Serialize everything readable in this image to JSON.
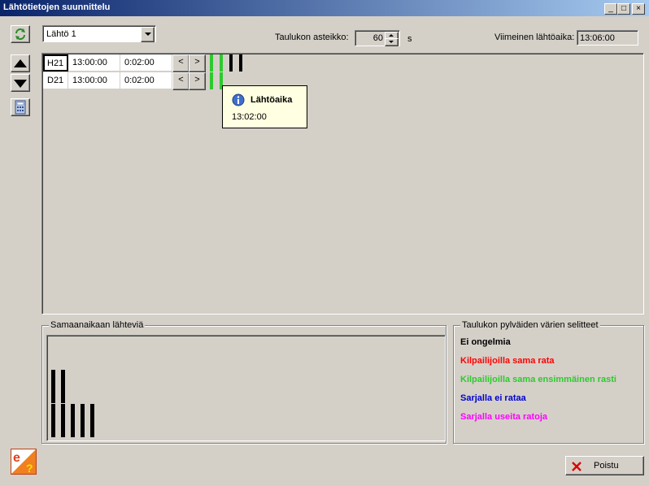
{
  "window": {
    "title": "Lähtötietojen suunnittelu",
    "minimize": "_",
    "maximize": "□",
    "close": "×"
  },
  "toolbar": {
    "start_select": "Lähtö 1",
    "scale_label": "Taulukon asteikko:",
    "scale_value": "60",
    "scale_unit": "s",
    "last_start_label": "Viimeinen lähtöaika:",
    "last_start_value": "13:06:00"
  },
  "table": {
    "rows": [
      {
        "cls": "H21",
        "start": "13:00:00",
        "interval": "0:02:00",
        "prev": "<",
        "next": ">"
      },
      {
        "cls": "D21",
        "start": "13:00:00",
        "interval": "0:02:00",
        "prev": "<",
        "next": ">"
      }
    ]
  },
  "tooltip": {
    "title": "Lähtöaika",
    "value": "13:02:00",
    "icon": "info-icon"
  },
  "simultaneous": {
    "title": "Samaanaikaan lähteviä",
    "bars": [
      2,
      2,
      1,
      1,
      1
    ]
  },
  "legend": {
    "title": "Taulukon pylväiden värien selitteet",
    "items": [
      {
        "label": "Ei ongelmia",
        "color": "#000000"
      },
      {
        "label": "Kilpailijoilla sama rata",
        "color": "#ff0000"
      },
      {
        "label": "Kilpailijoilla sama ensimmäinen rasti",
        "color": "#2ec92e"
      },
      {
        "label": "Sarjalla ei rataa",
        "color": "#0000cc"
      },
      {
        "label": "Sarjalla useita ratoja",
        "color": "#ff00ff"
      }
    ]
  },
  "footer": {
    "close_button": "Poistu"
  },
  "colors": {
    "title_gradient_start": "#0a246a",
    "title_gradient_end": "#a6caf0",
    "bar_green": "#2ec92e",
    "bar_black": "#000000"
  }
}
